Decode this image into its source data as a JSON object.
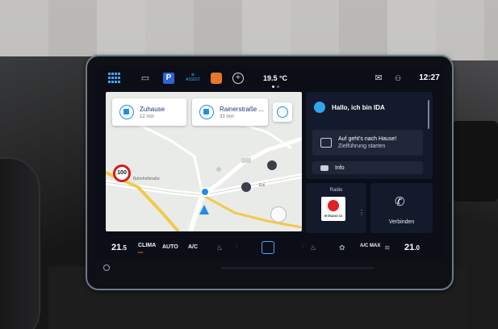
{
  "statusbar": {
    "apps_icon": "apps-grid-icon",
    "car_icon": "car-icon",
    "parking_label": "P",
    "assist_label": "ASSIST",
    "mode_icon": "drive-mode-icon",
    "add_icon": "plus-icon",
    "temperature": "19.5 °C",
    "message_icon": "message-icon",
    "network_icon": "network-icon",
    "time": "12:27"
  },
  "map": {
    "destinations": [
      {
        "name": "Zuhause",
        "eta": "12 min"
      },
      {
        "name": "Rainerstraße ...",
        "eta": "33 min"
      }
    ],
    "speed_limit": "100",
    "street_label": "Bahnhofstraße",
    "poi_label": "Eni",
    "colors": {
      "route": "#f2c94c",
      "position": "#1e8ee8"
    }
  },
  "assistant": {
    "title": "Hallo, ich bin IDA",
    "suggestion_title": "Auf geht's nach Hause!",
    "suggestion_subtitle": "Zielführung starten",
    "info_label": "Info"
  },
  "radio": {
    "label": "Radio",
    "station": "HITRADIO Ö3",
    "more": "⋮"
  },
  "phone": {
    "label": "Verbinden"
  },
  "climate": {
    "left_temp_main": "21",
    "left_temp_dec": ".5",
    "clima_label": "CLIMA",
    "clima_sub": "ECO",
    "auto_label": "AUTO",
    "ac_label": "A/C",
    "ac_max_label": "A/C MAX",
    "right_temp_main": "21",
    "right_temp_dec": ".0"
  }
}
